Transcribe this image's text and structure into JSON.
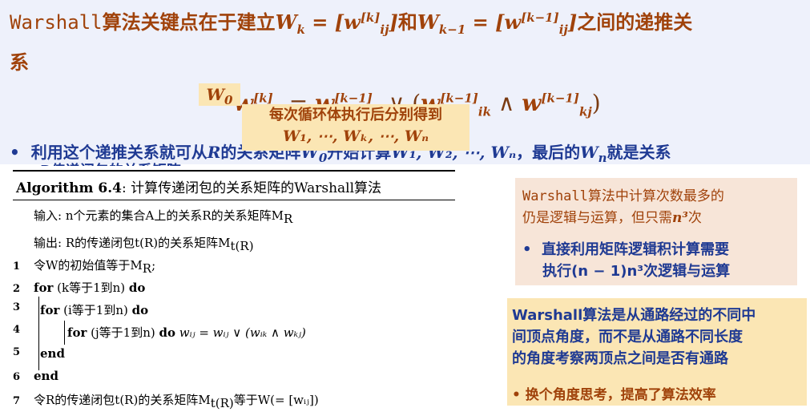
{
  "header": {
    "line1_prefix": "Warshall",
    "line1_a": "算法关键点在于建立",
    "wk": "W",
    "wk_sub": "k",
    "eq1": " = [",
    "w_ij_k_base": "w",
    "w_ij_k_sup": "[k]",
    "w_ij_k_sub": "ij",
    "close1": "]",
    "line1_b": "和",
    "wk1": "W",
    "wk1_sub": "k−1",
    "eq2": " = [",
    "w2_base": "w",
    "w2_sup": "[k−1]",
    "w2_sub": "ij",
    "close2": "]",
    "line1_c": "之间的递推关",
    "line2": "系"
  },
  "formula": {
    "lhs": "w",
    "lhs_sup": "[k]",
    "lhs_sub": "ij",
    "eq": " = ",
    "t1": "w",
    "t1_sup": "[k−1]",
    "t1_sub": "ij",
    "or": " ∨ (",
    "t2": "w",
    "t2_sup": "[k−1]",
    "t2_sub": "ik",
    "and": " ∧ ",
    "t3": "w",
    "t3_sup": "[k−1]",
    "t3_sub": "kj",
    "close": ")"
  },
  "bullet": {
    "dot": "•",
    "a": "利用这个递推关系就可从",
    "R": "R",
    "b": "的关系矩阵",
    "W0": "W",
    "W0_sub": "0",
    "c": "开始计算",
    "list": "W₁, W₂, ⋯, Wₙ",
    "d": "，最后的",
    "Wn": "W",
    "Wn_sub": "n",
    "e": "就是关系",
    "clipped": "R传递闭包的关系矩阵"
  },
  "algorithm": {
    "title_bold": "Algorithm 6.4",
    "title_rest": ": 计算传递闭包的关系矩阵的Warshall算法",
    "input": "输入: n个元素的集合A上的关系R的关系矩阵M",
    "input_sub": "R",
    "output": "输出: R的传递闭包t(R)的关系矩阵M",
    "output_sub": "t(R)",
    "lines": [
      {
        "n": "1",
        "text": "令W的初始值等于M",
        "sub": "R",
        "tail": ";"
      },
      {
        "n": "2",
        "kw": "for",
        "text": " (k等于1到n) ",
        "kw2": "do"
      },
      {
        "n": "3",
        "kw": "for",
        "text": " (i等于1到n) ",
        "kw2": "do"
      },
      {
        "n": "4",
        "kw": "for",
        "text": " (j等于1到n) ",
        "kw2": "do",
        "tail": " wᵢⱼ = wᵢⱼ ∨ (wᵢₖ ∧ wₖⱼ)"
      },
      {
        "n": "5",
        "kw": "end"
      },
      {
        "n": "6",
        "kw": "end"
      },
      {
        "n": "7",
        "text": "令R的传递闭包t(R)的关系矩阵M",
        "sub": "t(R)",
        "tail": "等于W(= [wᵢⱼ])"
      }
    ]
  },
  "w0_label": "W",
  "w0_sub": "0",
  "loop_note": {
    "line1": "每次循环体执行后分别得到",
    "line2": "W₁, ⋯, Wₖ, ⋯, Wₙ"
  },
  "box1": {
    "line1_prefix": "Warshall",
    "line1": "算法中计算次数最多的",
    "line2": "仍是逻辑与运算，但只需",
    "n3": "n³",
    "line2_tail": "次",
    "bullet_dot": "•",
    "b1": "直接利用矩阵逻辑积计算需要",
    "b2": "执行(n − 1)n³次逻辑与运算"
  },
  "box2": {
    "l1": "Warshall算法是从通路经过的不同中",
    "l2": "间顶点角度，而不是从通路不同长度",
    "l3": "的角度考察两顶点之间是否有通路",
    "bullet": "•  换个角度思考，提高了算法效率"
  },
  "colors": {
    "accent_brown": "#a0420a",
    "accent_blue": "#1f3a93",
    "band": "#eef1fb",
    "highlight": "#fbe6b4",
    "box_peach": "#f7e5d8"
  }
}
